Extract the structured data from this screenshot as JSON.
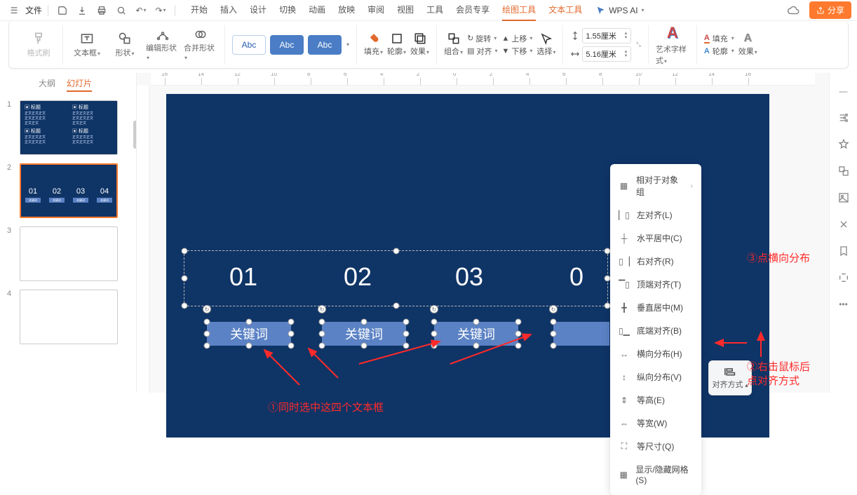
{
  "menubar": {
    "file": "文件",
    "tabs": [
      "开始",
      "插入",
      "设计",
      "切换",
      "动画",
      "放映",
      "审阅",
      "视图",
      "工具",
      "会员专享"
    ],
    "context_tabs": [
      {
        "label": "绘图工具",
        "active": true
      },
      {
        "label": "文本工具",
        "active": false
      }
    ],
    "ai_label": "WPS AI",
    "share_label": "分享"
  },
  "ribbon": {
    "format_painter": "格式刷",
    "textbox": "文本框",
    "shape": "形状",
    "edit_shape": "编辑形状",
    "combine_shape": "合并形状",
    "abc": "Abc",
    "fill": "填充",
    "outline": "轮廓",
    "effect": "效果",
    "group": "组合",
    "rotate": "旋转",
    "align": "对齐",
    "moveup": "上移",
    "movedown": "下移",
    "select": "选择",
    "width_label": "1.55厘米",
    "height_label": "5.16厘米",
    "wordart": "艺术字样式",
    "textfill": "填充",
    "textoutline": "轮廓",
    "texteffect": "效果"
  },
  "sidepanel": {
    "tabs": {
      "outline": "大纲",
      "slides": "幻灯片"
    },
    "slides": [
      {
        "n": "1"
      },
      {
        "n": "2",
        "selected": true,
        "items": [
          "01",
          "02",
          "03",
          "04"
        ],
        "kw": "关键词"
      },
      {
        "n": "3"
      },
      {
        "n": "4"
      }
    ]
  },
  "slide": {
    "numbers": [
      "01",
      "02",
      "03",
      "0"
    ],
    "keywords": [
      "关键词",
      "关键词",
      "关键词"
    ],
    "annotation1": "①同时选中这四个文本框",
    "annotation2": "③点横向分布",
    "annotation3_line1": "②右击鼠标后",
    "annotation3_line2": "点对齐方式"
  },
  "ruler_ticks": [
    "16",
    "14",
    "12",
    "10",
    "8",
    "6",
    "4",
    "2",
    "0",
    "2",
    "4",
    "6",
    "8",
    "10",
    "12",
    "14",
    "16"
  ],
  "context_menu": {
    "relative_to_group": "相对于对象组",
    "align_left": "左对齐(L)",
    "align_center_h": "水平居中(C)",
    "align_right": "右对齐(R)",
    "align_top": "顶端对齐(T)",
    "align_middle_v": "垂直居中(M)",
    "align_bottom": "底端对齐(B)",
    "dist_h": "横向分布(H)",
    "dist_v": "纵向分布(V)",
    "eq_height": "等高(E)",
    "eq_width": "等宽(W)",
    "eq_size": "等尺寸(Q)",
    "show_hide_grid": "显示/隐藏网格(S)"
  },
  "float_button": "对齐方式"
}
